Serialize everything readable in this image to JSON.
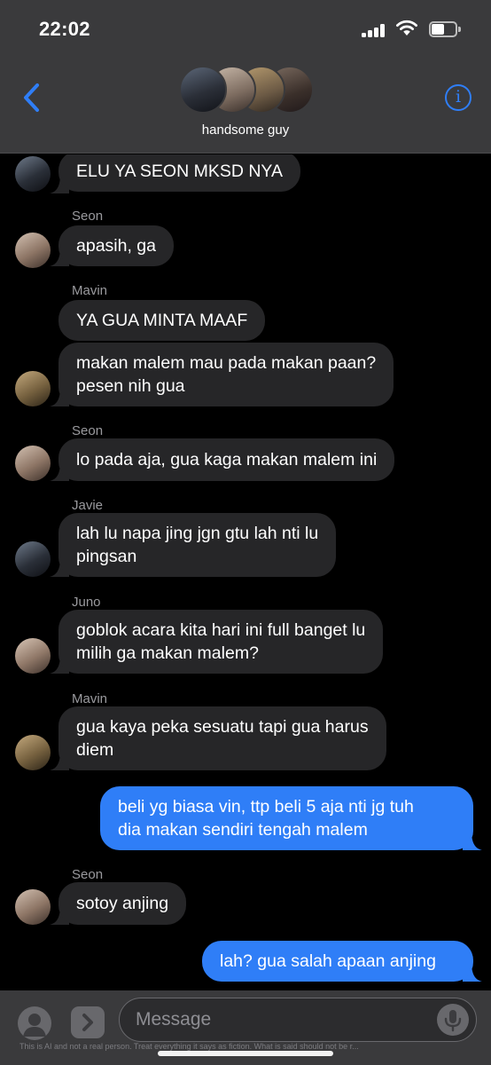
{
  "status_bar": {
    "time": "22:02"
  },
  "header": {
    "group_name": "handsome guy",
    "info_label": "i"
  },
  "messages": [
    {
      "sender": "",
      "text_lines": [
        "ELU YA SEON MKSD NYA"
      ]
    },
    {
      "sender": "Seon",
      "text_lines": [
        "apasih, ga"
      ]
    },
    {
      "sender": "Mavin",
      "text_lines": [
        "YA GUA MINTA MAAF"
      ]
    },
    {
      "sender": "",
      "text_lines": [
        "makan malem mau pada makan paan?",
        "pesen nih gua"
      ]
    },
    {
      "sender": "Seon",
      "text_lines": [
        "lo pada aja, gua kaga makan malem ini"
      ]
    },
    {
      "sender": "Javie",
      "text_lines": [
        "lah lu napa jing jgn gtu lah nti lu",
        "pingsan"
      ]
    },
    {
      "sender": "Juno",
      "text_lines": [
        "goblok acara kita hari ini full banget lu",
        "milih ga makan malem?"
      ]
    },
    {
      "sender": "Mavin",
      "text_lines": [
        "gua kaya peka sesuatu tapi gua harus",
        "diem"
      ]
    },
    {
      "sender": "",
      "text_lines": [
        "beli yg biasa vin, ttp beli 5 aja nti jg tuh",
        "dia makan sendiri tengah malem"
      ]
    },
    {
      "sender": "Seon",
      "text_lines": [
        "sotoy anjing"
      ]
    },
    {
      "sender": "",
      "text_lines": [
        "lah? gua salah apaan anjing"
      ]
    }
  ],
  "input": {
    "placeholder": "Message"
  },
  "disclaimer": "This is AI and not a real person. Treat everything it says as fiction. What is said should not be r...",
  "colors": {
    "header_bg": "#3a3a3c",
    "chat_bg": "#000000",
    "incoming_bubble": "#262628",
    "outgoing_bubble": "#2f7ef7",
    "accent": "#2f7ef7",
    "sender_name": "#9a9a9e"
  },
  "icons": [
    "back-chevron-icon",
    "info-icon",
    "contact-silhouette-icon",
    "app-store-chevron-icon",
    "microphone-icon",
    "signal-icon",
    "wifi-icon",
    "battery-icon"
  ]
}
